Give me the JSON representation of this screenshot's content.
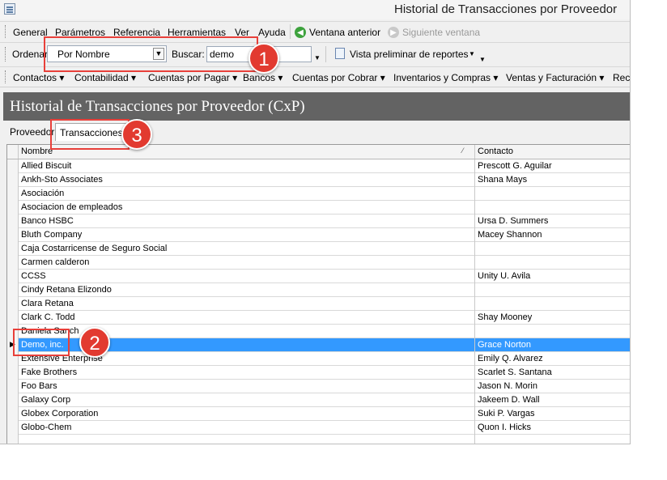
{
  "window": {
    "title": "Historial de Transacciones por Proveedor"
  },
  "menubar": {
    "items": [
      "General",
      "Parámetros",
      "Referencia",
      "Herramientas",
      "Ver",
      "Ayuda"
    ],
    "prev_window": "Ventana anterior",
    "next_window": "Siguiente ventana"
  },
  "filterbar": {
    "sort_label": "Ordenar:",
    "sort_value": "Por Nombre",
    "search_label": "Buscar:",
    "search_value": "demo",
    "preview_label": "Vista preliminar de reportes"
  },
  "modules": [
    "Contactos",
    "Contabilidad",
    "Cuentas por Pagar",
    "Bancos",
    "Cuentas por Cobrar",
    "Inventarios y Compras",
    "Ventas y Facturación",
    "Rec"
  ],
  "page_header": "Historial de Transacciones por Proveedor (CxP)",
  "tabs": [
    "Proveedor",
    "Transacciones"
  ],
  "grid": {
    "columns": [
      "Nombre",
      "Contacto"
    ],
    "rows": [
      {
        "name": "Allied Biscuit",
        "contact": "Prescott G. Aguilar"
      },
      {
        "name": "Ankh-Sto Associates",
        "contact": "Shana Mays"
      },
      {
        "name": "Asociación",
        "contact": ""
      },
      {
        "name": "Asociacion de empleados",
        "contact": ""
      },
      {
        "name": "Banco HSBC",
        "contact": "Ursa D. Summers"
      },
      {
        "name": "Bluth Company",
        "contact": "Macey Shannon"
      },
      {
        "name": "Caja Costarricense de Seguro Social",
        "contact": ""
      },
      {
        "name": "Carmen calderon",
        "contact": ""
      },
      {
        "name": "CCSS",
        "contact": "Unity U. Avila"
      },
      {
        "name": "Cindy Retana Elizondo",
        "contact": ""
      },
      {
        "name": "Clara Retana",
        "contact": ""
      },
      {
        "name": "Clark C. Todd",
        "contact": "Shay Mooney"
      },
      {
        "name": "Daniela Sanch",
        "contact": ""
      },
      {
        "name": "Demo, inc.",
        "contact": "Grace Norton"
      },
      {
        "name": "Extensive Enterprise",
        "contact": "Emily Q. Alvarez"
      },
      {
        "name": "Fake Brothers",
        "contact": "Scarlet S. Santana"
      },
      {
        "name": "Foo Bars",
        "contact": "Jason N. Morin"
      },
      {
        "name": "Galaxy Corp",
        "contact": "Jakeem D. Wall"
      },
      {
        "name": "Globex Corporation",
        "contact": "Suki P. Vargas"
      },
      {
        "name": "Globo-Chem",
        "contact": "Quon I. Hicks"
      },
      {
        "name": "",
        "contact": ""
      }
    ]
  },
  "callouts": [
    "1",
    "2",
    "3"
  ],
  "colors": {
    "selection": "#3399ff",
    "header_band": "#636363",
    "callout": "#e23a30"
  }
}
